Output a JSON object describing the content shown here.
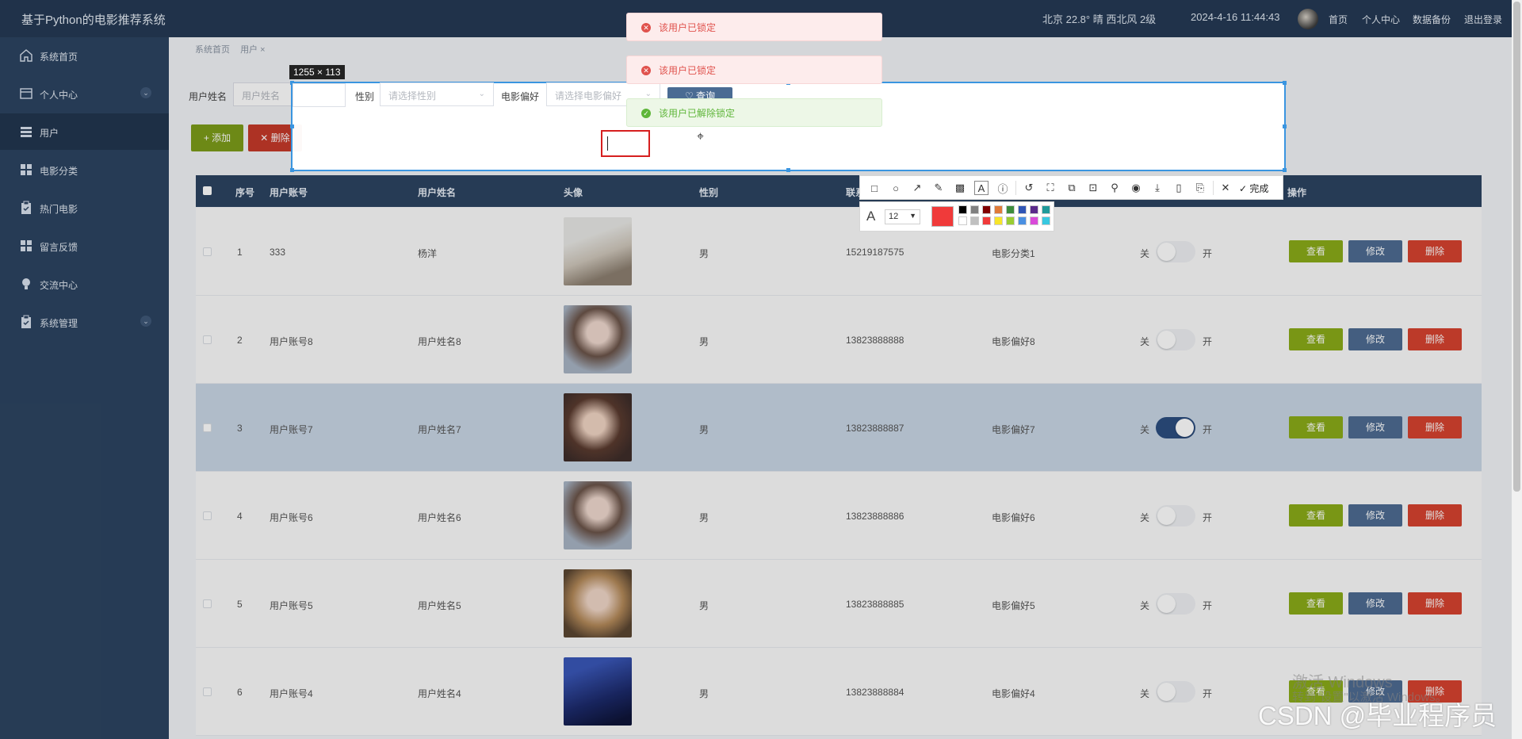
{
  "header": {
    "title": "基于Python的电影推荐系统",
    "weather": "北京  22.8°  晴  西北风  2级",
    "datetime": "2024-4-16 11:44:43",
    "nav": [
      "首页",
      "个人中心",
      "数据备份",
      "退出登录"
    ]
  },
  "sidebar": {
    "items": [
      {
        "label": "系统首页",
        "icon": "home-icon"
      },
      {
        "label": "个人中心",
        "icon": "profile-icon",
        "expand": true
      },
      {
        "label": "用户",
        "icon": "list-icon"
      },
      {
        "label": "电影分类",
        "icon": "grid-icon"
      },
      {
        "label": "热门电影",
        "icon": "clipboard-icon"
      },
      {
        "label": "留言反馈",
        "icon": "grid-icon"
      },
      {
        "label": "交流中心",
        "icon": "bulb-icon"
      },
      {
        "label": "系统管理",
        "icon": "clipboard-icon",
        "expand": true
      }
    ]
  },
  "breadcrumb": [
    "系统首页",
    "用户 ×"
  ],
  "filters": {
    "name_label": "用户姓名",
    "name_placeholder": "用户姓名",
    "gender_label": "性别",
    "gender_placeholder": "请选择性别",
    "pref_label": "电影偏好",
    "pref_placeholder": "请选择电影偏好",
    "query_button": "♡ 查询"
  },
  "actions": {
    "add": "+ 添加",
    "delete": "✕ 删除"
  },
  "table": {
    "columns": [
      "序号",
      "用户账号",
      "用户姓名",
      "头像",
      "性别",
      "联系",
      "操作"
    ],
    "switch_off": "关",
    "switch_on": "开",
    "row_buttons": {
      "view": "查看",
      "edit": "修改",
      "remove": "删除"
    },
    "rows": [
      {
        "idx": "1",
        "account": "333",
        "name": "杨洋",
        "gender": "男",
        "phone": "15219187575",
        "pref": "电影分类1",
        "switch": false
      },
      {
        "idx": "2",
        "account": "用户账号8",
        "name": "用户姓名8",
        "gender": "男",
        "phone": "13823888888",
        "pref": "电影偏好8",
        "switch": false
      },
      {
        "idx": "3",
        "account": "用户账号7",
        "name": "用户姓名7",
        "gender": "男",
        "phone": "13823888887",
        "pref": "电影偏好7",
        "switch": true
      },
      {
        "idx": "4",
        "account": "用户账号6",
        "name": "用户姓名6",
        "gender": "男",
        "phone": "13823888886",
        "pref": "电影偏好6",
        "switch": false
      },
      {
        "idx": "5",
        "account": "用户账号5",
        "name": "用户姓名5",
        "gender": "男",
        "phone": "13823888885",
        "pref": "电影偏好5",
        "switch": false
      },
      {
        "idx": "6",
        "account": "用户账号4",
        "name": "用户姓名4",
        "gender": "男",
        "phone": "13823888884",
        "pref": "电影偏好4",
        "switch": false
      }
    ]
  },
  "toasts": [
    {
      "type": "error",
      "text": "该用户已锁定"
    },
    {
      "type": "error",
      "text": "该用户已锁定"
    },
    {
      "type": "success",
      "text": "该用户已解除锁定"
    }
  ],
  "capture": {
    "size_label": "1255 × 113",
    "font_size": "12",
    "done_label": "完成",
    "current_color": "#f03a3a",
    "palette": [
      "#000000",
      "#808080",
      "#800000",
      "#e07b39",
      "#3c8c3c",
      "#2f55b5",
      "#5a2a8a",
      "#1f9a9a",
      "#ffffff",
      "#c0c0c0",
      "#f03a3a",
      "#f7e52a",
      "#9acd32",
      "#4a90e2",
      "#d94ad9",
      "#38c8e0"
    ]
  },
  "watermark": {
    "line1": "激活 Windows",
    "line2": "转到\"设置\"以激活 Windows。",
    "site": "CSDN @毕业程序员"
  }
}
